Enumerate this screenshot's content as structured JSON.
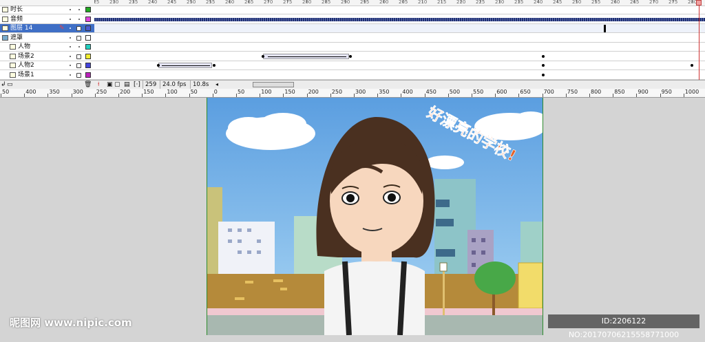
{
  "timeline": {
    "ruler_labels": [
      "225",
      "230",
      "235",
      "240",
      "245",
      "250",
      "255",
      "260",
      "265",
      "270",
      "275",
      "280",
      "285",
      "290",
      "295",
      "200",
      "205",
      "210",
      "215",
      "220",
      "225",
      "230",
      "235",
      "240",
      "245",
      "250",
      "255",
      "260",
      "265",
      "270",
      "275",
      "280"
    ],
    "layers": [
      {
        "name": "时长",
        "color": "#22aa22",
        "selected": false
      },
      {
        "name": "音频",
        "color": "#dd44dd",
        "selected": false
      },
      {
        "name": "图层 14",
        "color": "#4a5bd0",
        "selected": true
      },
      {
        "name": "遮罩",
        "color": "#ffffff",
        "selected": false
      },
      {
        "name": "人物",
        "color": "#22d0c0",
        "selected": false
      },
      {
        "name": "场景2",
        "color": "#f2ee30",
        "selected": false
      },
      {
        "name": "人物2",
        "color": "#4444dd",
        "selected": false
      },
      {
        "name": "场景1",
        "color": "#bb22bb",
        "selected": false
      }
    ],
    "current_frame": "259",
    "fps": "24.0 fps",
    "elapsed": "10.8s"
  },
  "stage_ruler": [
    "50",
    "400",
    "350",
    "300",
    "250",
    "200",
    "150",
    "100",
    "50",
    "0",
    "50",
    "100",
    "150",
    "200",
    "250",
    "300",
    "350",
    "400",
    "450",
    "500",
    "550",
    "600",
    "650",
    "700",
    "750",
    "800",
    "850",
    "900",
    "950",
    "1000",
    "1050"
  ],
  "stage": {
    "caption": "好漂亮的学校!",
    "caption_color": "#e2622b",
    "sky_color": "#5aa0dc"
  },
  "watermark": {
    "left": "昵图网 www.nipic.com",
    "right": "ID:2206122 NO:20170706215558771000"
  }
}
